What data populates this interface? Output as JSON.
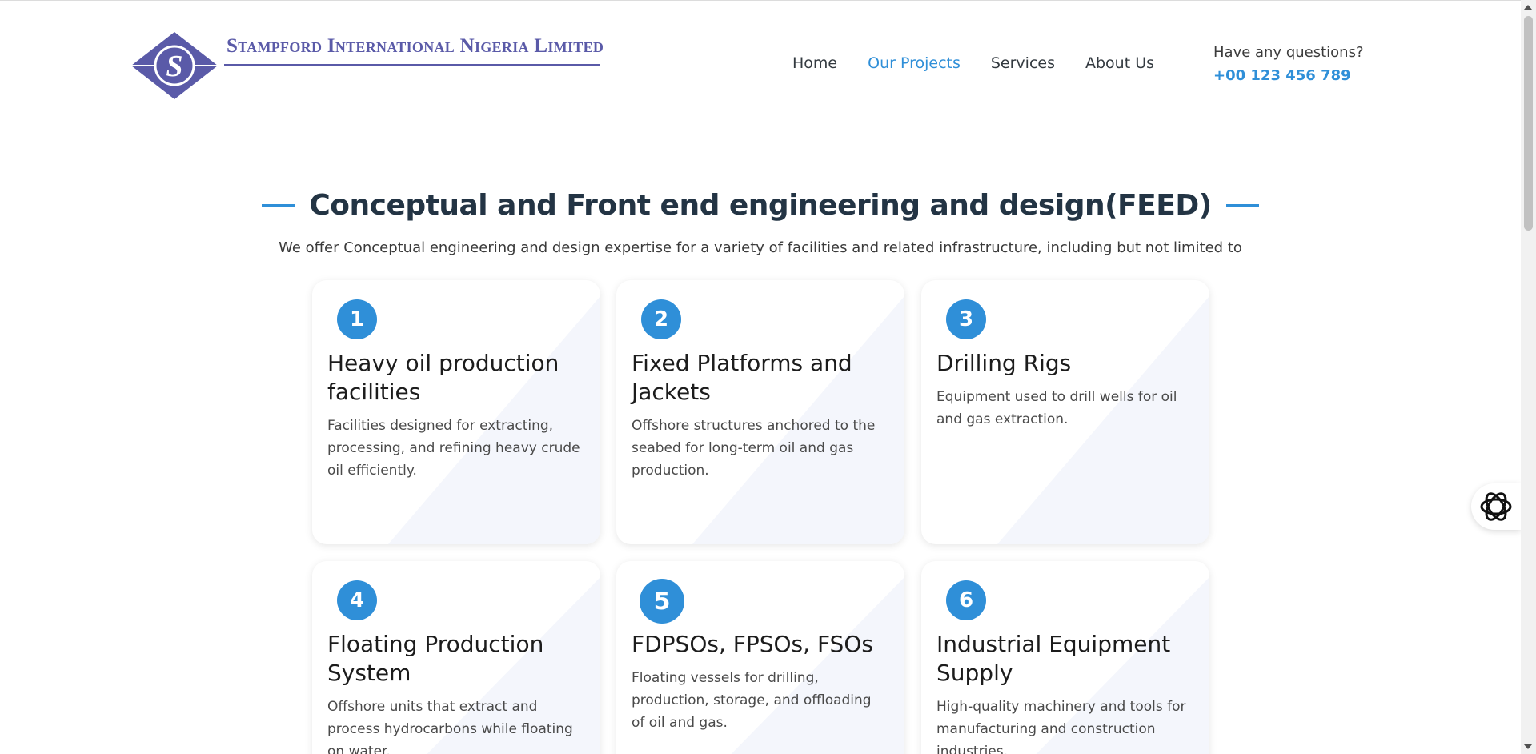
{
  "brand": {
    "name": "Stampford International Nigeria Limited",
    "logo_letter": "S",
    "color": "#5a5aa8"
  },
  "nav": {
    "items": [
      {
        "label": "Home",
        "active": false
      },
      {
        "label": "Our Projects",
        "active": true
      },
      {
        "label": "Services",
        "active": false
      },
      {
        "label": "About Us",
        "active": false
      }
    ]
  },
  "contact": {
    "question": "Have any questions?",
    "phone": "+00 123 456 789"
  },
  "section": {
    "title": "Conceptual and Front end engineering and design(FEED)",
    "subtitle": "We offer Conceptual engineering and design expertise for a variety of facilities and related infrastructure, including but not limited to"
  },
  "cards": [
    {
      "number": "1",
      "title": "Heavy oil production facilities",
      "description": "Facilities designed for extracting, processing, and refining heavy crude oil efficiently."
    },
    {
      "number": "2",
      "title": "Fixed Platforms and Jackets",
      "description": "Offshore structures anchored to the seabed for long-term oil and gas production."
    },
    {
      "number": "3",
      "title": "Drilling Rigs",
      "description": "Equipment used to drill wells for oil and gas extraction."
    },
    {
      "number": "4",
      "title": "Floating Production System",
      "description": "Offshore units that extract and process hydrocarbons while floating on water."
    },
    {
      "number": "5",
      "title": "FDPSOs, FPSOs, FSOs",
      "description": "Floating vessels for drilling, production, storage, and offloading of oil and gas."
    },
    {
      "number": "6",
      "title": "Industrial Equipment Supply",
      "description": "High-quality machinery and tools for manufacturing and construction industries."
    }
  ],
  "colors": {
    "accent": "#2f8fd8",
    "heading": "#233444",
    "card_pattern": "#f4f6fc"
  },
  "icons": {
    "widget": "ai-assistant-icon"
  }
}
